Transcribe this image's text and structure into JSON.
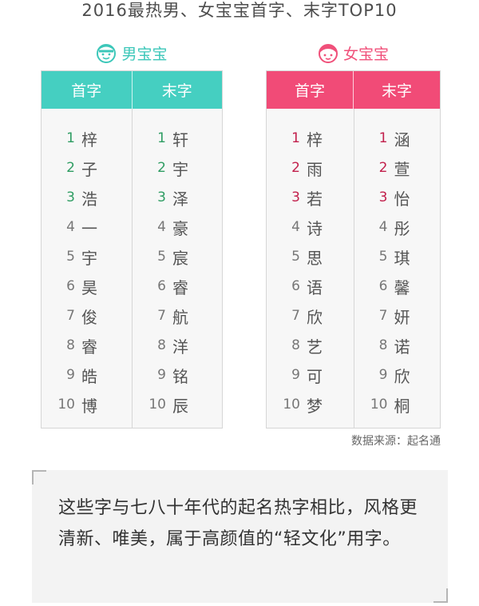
{
  "title": "2016最热男、女宝宝首字、末字TOP10",
  "boy": {
    "label": "男宝宝",
    "icon": "boy-face-icon",
    "color": "#45cfc1",
    "headers": [
      "首字",
      "末字"
    ],
    "first": [
      {
        "n": "1",
        "c": "梓"
      },
      {
        "n": "2",
        "c": "子"
      },
      {
        "n": "3",
        "c": "浩"
      },
      {
        "n": "4",
        "c": "一"
      },
      {
        "n": "5",
        "c": "宇"
      },
      {
        "n": "6",
        "c": "昊"
      },
      {
        "n": "7",
        "c": "俊"
      },
      {
        "n": "8",
        "c": "睿"
      },
      {
        "n": "9",
        "c": "皓"
      },
      {
        "n": "10",
        "c": "博"
      }
    ],
    "last": [
      {
        "n": "1",
        "c": "轩"
      },
      {
        "n": "2",
        "c": "宇"
      },
      {
        "n": "3",
        "c": "泽"
      },
      {
        "n": "4",
        "c": "豪"
      },
      {
        "n": "5",
        "c": "宸"
      },
      {
        "n": "6",
        "c": "睿"
      },
      {
        "n": "7",
        "c": "航"
      },
      {
        "n": "8",
        "c": "洋"
      },
      {
        "n": "9",
        "c": "铭"
      },
      {
        "n": "10",
        "c": "辰"
      }
    ]
  },
  "girl": {
    "label": "女宝宝",
    "icon": "girl-face-icon",
    "color": "#f14b77",
    "headers": [
      "首字",
      "末字"
    ],
    "first": [
      {
        "n": "1",
        "c": "梓"
      },
      {
        "n": "2",
        "c": "雨"
      },
      {
        "n": "3",
        "c": "若"
      },
      {
        "n": "4",
        "c": "诗"
      },
      {
        "n": "5",
        "c": "思"
      },
      {
        "n": "6",
        "c": "语"
      },
      {
        "n": "7",
        "c": "欣"
      },
      {
        "n": "8",
        "c": "艺"
      },
      {
        "n": "9",
        "c": "可"
      },
      {
        "n": "10",
        "c": "梦"
      }
    ],
    "last": [
      {
        "n": "1",
        "c": "涵"
      },
      {
        "n": "2",
        "c": "萱"
      },
      {
        "n": "3",
        "c": "怡"
      },
      {
        "n": "4",
        "c": "彤"
      },
      {
        "n": "5",
        "c": "琪"
      },
      {
        "n": "6",
        "c": "馨"
      },
      {
        "n": "7",
        "c": "妍"
      },
      {
        "n": "8",
        "c": "诺"
      },
      {
        "n": "9",
        "c": "欣"
      },
      {
        "n": "10",
        "c": "桐"
      }
    ]
  },
  "source": "数据来源：起名通",
  "quote": "这些字与七八十年代的起名热字相比，风格更清新、唯美，属于高颜值的“轻文化”用字。"
}
